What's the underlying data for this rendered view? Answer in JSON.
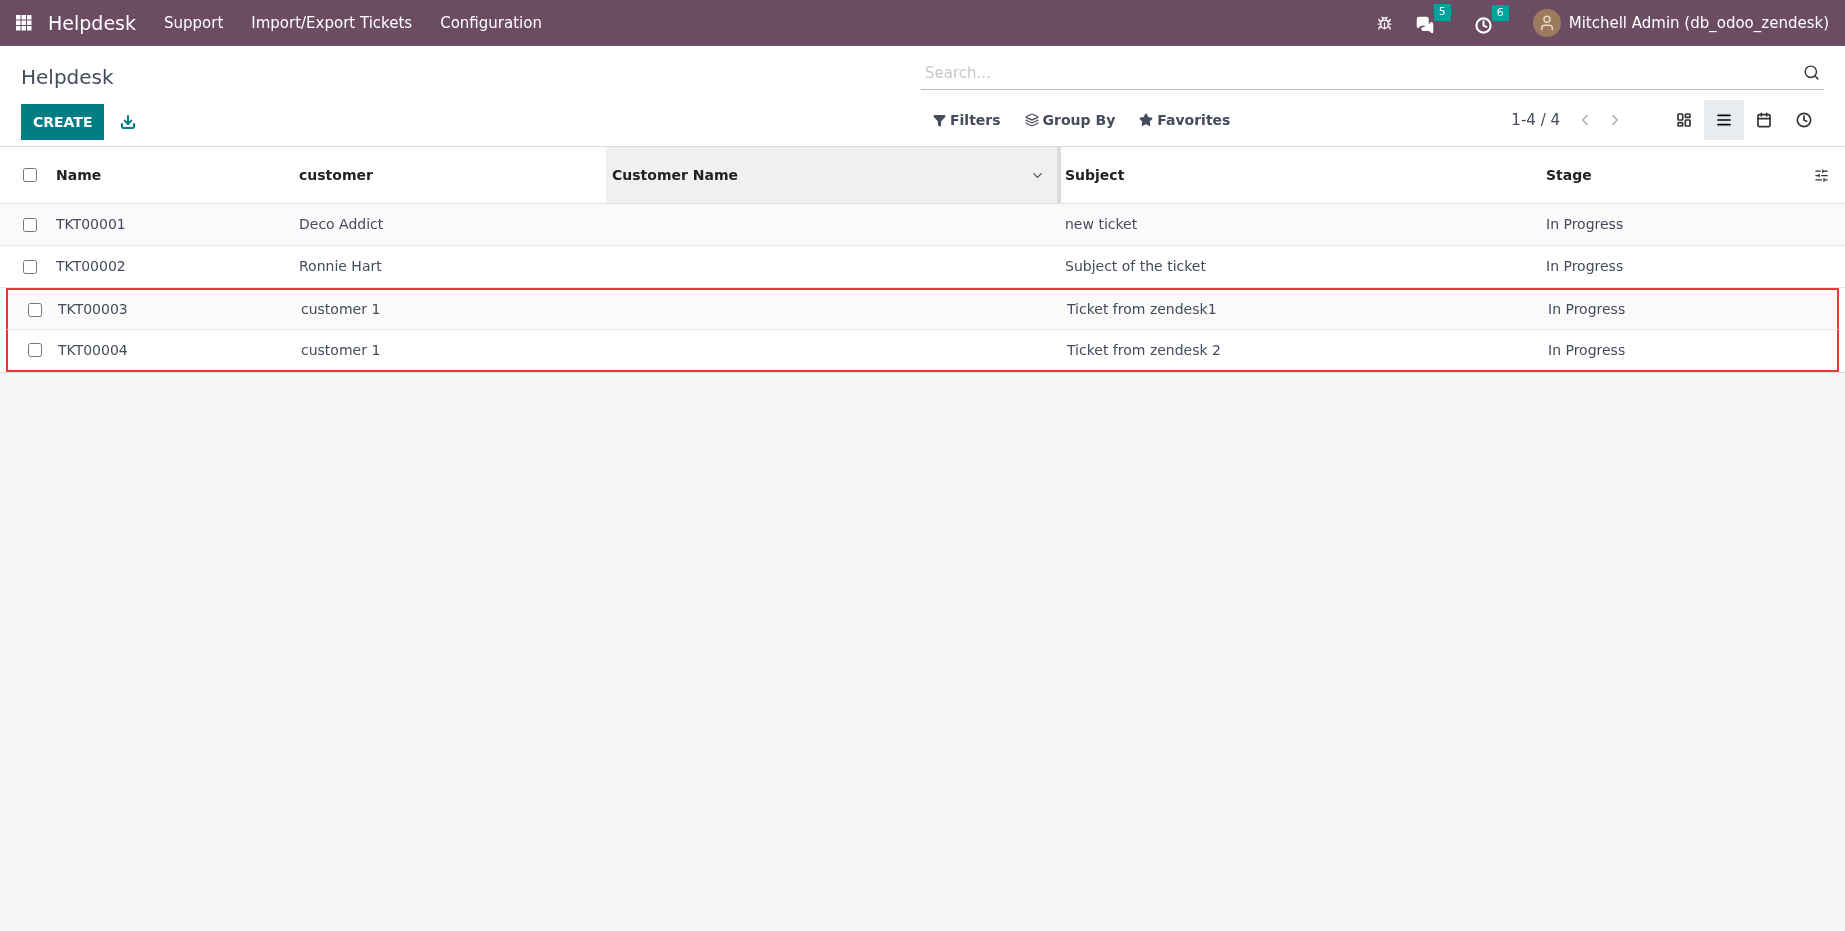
{
  "navbar": {
    "app_name": "Helpdesk",
    "menu": [
      "Support",
      "Import/Export Tickets",
      "Configuration"
    ],
    "messages_count": "5",
    "activities_count": "6",
    "user": "Mitchell Admin (db_odoo_zendesk)"
  },
  "control_panel": {
    "title": "Helpdesk",
    "create_label": "CREATE",
    "search": {
      "placeholder": "Search..."
    },
    "filters": [
      {
        "kind": "filter",
        "label": "Filters"
      },
      {
        "kind": "group",
        "label": "Group By"
      },
      {
        "kind": "favorite",
        "label": "Favorites"
      }
    ],
    "pager": "1-4 / 4",
    "views": [
      {
        "kind": "kanban",
        "selected": false
      },
      {
        "kind": "list",
        "selected": true
      },
      {
        "kind": "calendar",
        "selected": false
      },
      {
        "kind": "activity",
        "selected": false
      }
    ]
  },
  "table": {
    "select_all_checked": false,
    "columns": [
      {
        "label": "Name",
        "active": false
      },
      {
        "label": "customer",
        "active": false
      },
      {
        "label": "Customer Name",
        "active": true
      },
      {
        "label": "Subject",
        "active": false
      },
      {
        "label": "Stage",
        "active": false
      }
    ],
    "rows": [
      {
        "cells": [
          "TKT00001",
          "Deco Addict",
          "",
          "new ticket",
          "In Progress"
        ],
        "checked": false,
        "highlighted": false
      },
      {
        "cells": [
          "TKT00002",
          "Ronnie Hart",
          "",
          "Subject of the ticket",
          "In Progress"
        ],
        "checked": false,
        "highlighted": false
      },
      {
        "cells": [
          "TKT00003",
          "customer 1",
          "",
          "Ticket from zendesk1",
          "In Progress"
        ],
        "checked": false,
        "highlighted": true
      },
      {
        "cells": [
          "TKT00004",
          "customer 1",
          "",
          "Ticket from zendesk 2",
          "In Progress"
        ],
        "checked": false,
        "highlighted": true
      }
    ]
  }
}
